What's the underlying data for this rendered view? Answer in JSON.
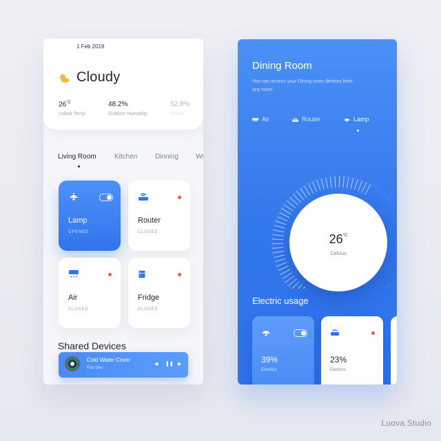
{
  "colors": {
    "accent": "#3174ec",
    "status_off": "#ef5b45",
    "sun": "#f6b73c"
  },
  "weather": {
    "date": "1 Feb 2019",
    "condition": "Cloudy",
    "icon": "partly-cloudy-icon",
    "stats": [
      {
        "value": "26",
        "unit": "°C",
        "label": "Indoor Temp"
      },
      {
        "value": "48.2%",
        "unit": "",
        "label": "Outdoor Humadity"
      },
      {
        "value": "52.9%",
        "unit": "",
        "label": "Indoor"
      }
    ]
  },
  "rooms": {
    "tabs": [
      "Living Room",
      "Kitchen",
      "Dinning",
      "Wo"
    ],
    "active": "Living Room"
  },
  "devices": [
    {
      "name": "Lamp",
      "state": "OPENED",
      "icon": "lamp-icon",
      "on": true
    },
    {
      "name": "Router",
      "state": "CLOSED",
      "icon": "router-icon",
      "on": false
    },
    {
      "name": "Air",
      "state": "CLOSED",
      "icon": "air-conditioner-icon",
      "on": false
    },
    {
      "name": "Fridge",
      "state": "CLOSED",
      "icon": "fridge-icon",
      "on": false
    }
  ],
  "shared": {
    "title": "Shared Devices",
    "player": {
      "song": "Cold Water Cover",
      "artist": "Raz Dee",
      "controls": [
        "previous-icon",
        "pause-icon",
        "next-icon"
      ]
    }
  },
  "dining": {
    "title": "Dining Room",
    "subtitle": "You can access your Dining room devices from any room.",
    "tabs": [
      {
        "label": "Air",
        "icon": "air-conditioner-icon"
      },
      {
        "label": "Router",
        "icon": "router-icon"
      },
      {
        "label": "Lamp",
        "icon": "lamp-icon"
      }
    ],
    "active_tab": "Lamp",
    "thermostat": {
      "value": "26",
      "unit": "°C",
      "caption": "Celcius"
    },
    "usage": {
      "title": "Electric usage",
      "cards": [
        {
          "percent": "39%",
          "label": "Electrics",
          "icon": "lamp-icon",
          "on": true
        },
        {
          "percent": "23%",
          "label": "Electrics",
          "icon": "router-icon",
          "on": false
        }
      ]
    }
  },
  "watermark": "Luova.Studio"
}
